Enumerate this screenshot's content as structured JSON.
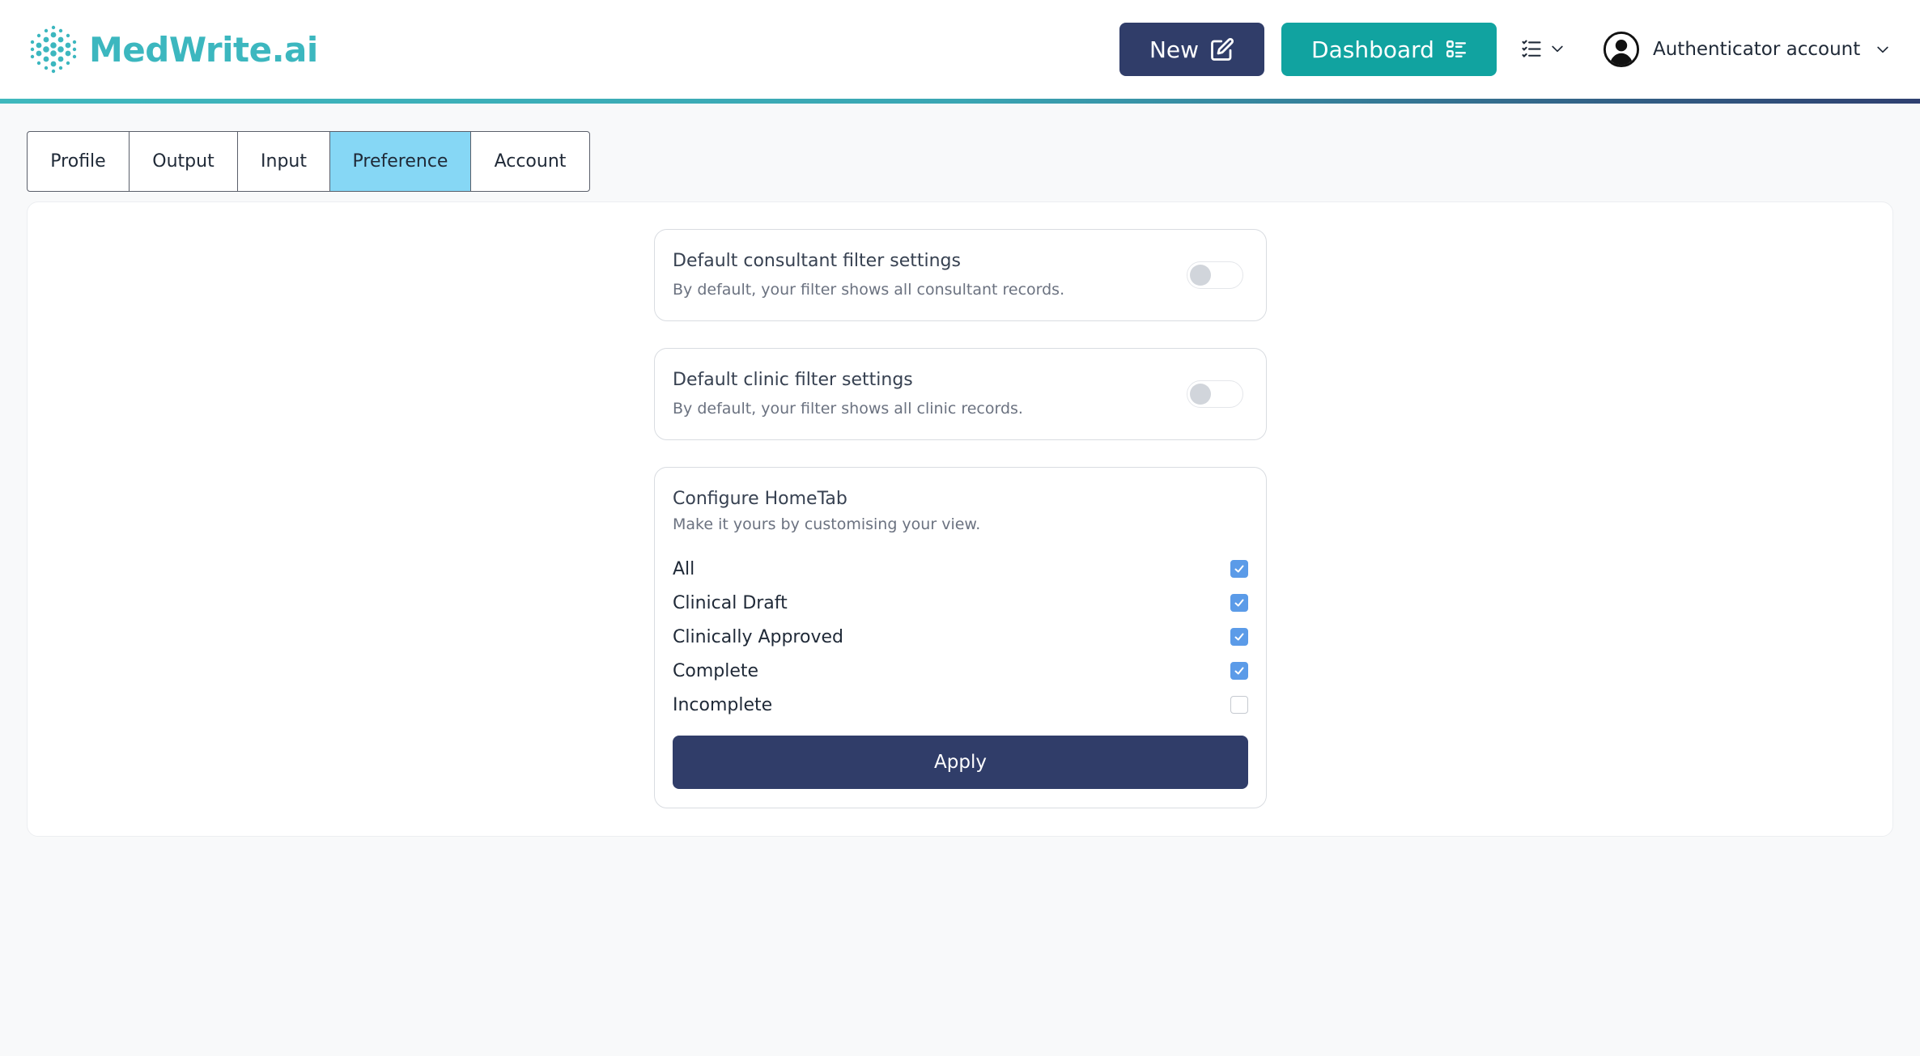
{
  "brand": {
    "name": "MedWrite.ai",
    "color": "#3cb7bf"
  },
  "header": {
    "new_label": "New",
    "dashboard_label": "Dashboard",
    "account_label": "Authenticator account"
  },
  "tabs": [
    {
      "label": "Profile",
      "active": false
    },
    {
      "label": "Output",
      "active": false
    },
    {
      "label": "Input",
      "active": false
    },
    {
      "label": "Preference",
      "active": true
    },
    {
      "label": "Account",
      "active": false
    }
  ],
  "consultant_filter": {
    "title": "Default consultant filter settings",
    "description": "By default, your filter shows all consultant records.",
    "enabled": false
  },
  "clinic_filter": {
    "title": "Default clinic filter settings",
    "description": "By default, your filter shows all clinic records.",
    "enabled": false
  },
  "hometab": {
    "title": "Configure HomeTab",
    "description": "Make it yours by customising your view.",
    "options": [
      {
        "label": "All",
        "checked": true
      },
      {
        "label": "Clinical Draft",
        "checked": true
      },
      {
        "label": "Clinically Approved",
        "checked": true
      },
      {
        "label": "Complete",
        "checked": true
      },
      {
        "label": "Incomplete",
        "checked": false
      }
    ],
    "apply_label": "Apply"
  },
  "colors": {
    "primary_navy": "#303d69",
    "teal": "#11a3a0",
    "active_tab": "#86d7f5",
    "checkbox_blue": "#5b9be8"
  }
}
